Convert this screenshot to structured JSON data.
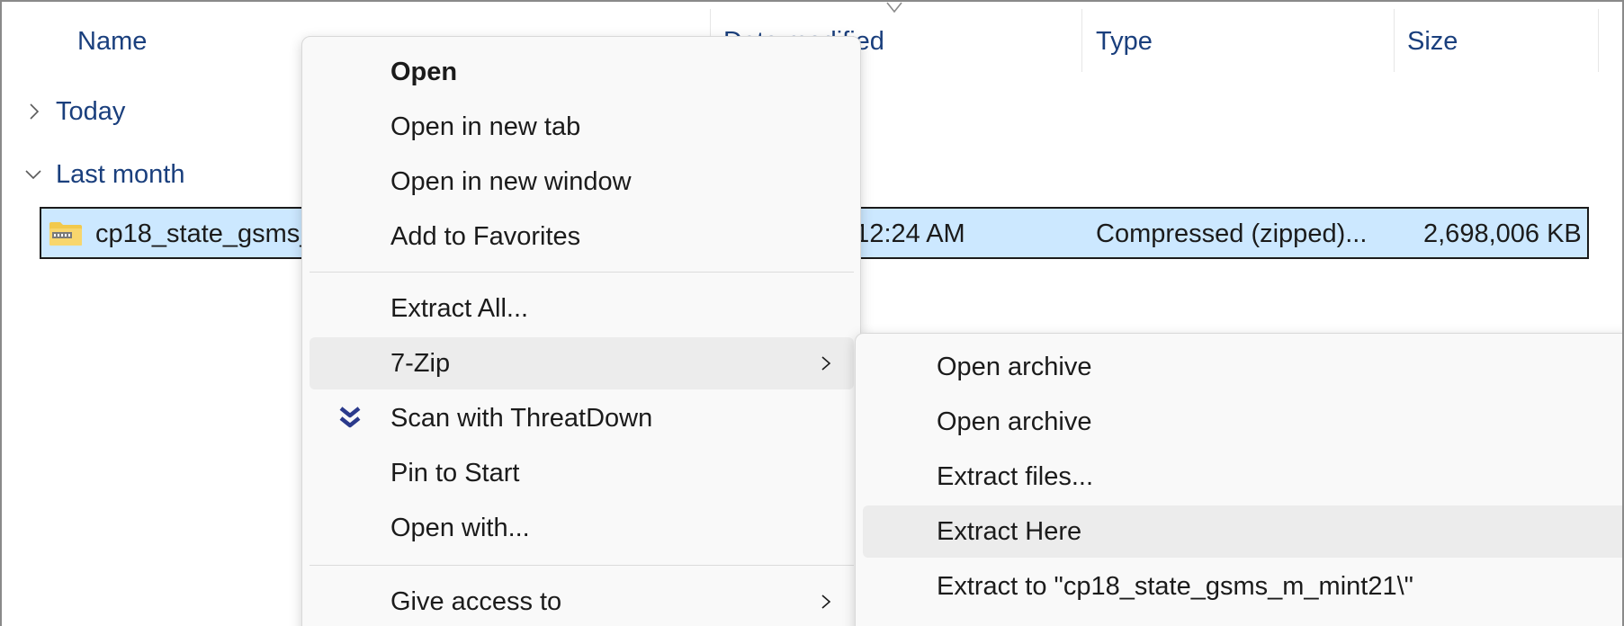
{
  "columns": {
    "name": "Name",
    "date_modified": "Date modified",
    "type": "Type",
    "size": "Size"
  },
  "groups": [
    {
      "label": "Today",
      "expanded": false
    },
    {
      "label": "Last month",
      "expanded": true
    }
  ],
  "file": {
    "name": "cp18_state_gsms_m_mint21.zip",
    "date_modified": "6 12:24 AM",
    "type": "Compressed (zipped)...",
    "size": "2,698,006 KB",
    "icon": "zip-folder-icon"
  },
  "context_menu": {
    "items": [
      {
        "label": "Open",
        "bold": true
      },
      {
        "label": "Open in new tab"
      },
      {
        "label": "Open in new window"
      },
      {
        "label": "Add to Favorites"
      },
      {
        "label": "Extract All..."
      },
      {
        "label": "7-Zip",
        "has_submenu": true,
        "highlighted": true
      },
      {
        "label": "Scan with ThreatDown",
        "icon": "threatdown-icon"
      },
      {
        "label": "Pin to Start"
      },
      {
        "label": "Open with..."
      },
      {
        "label": "Give access to",
        "has_submenu": true
      }
    ]
  },
  "submenu_7zip": {
    "items": [
      {
        "label": "Open archive"
      },
      {
        "label": "Open archive"
      },
      {
        "label": "Extract files..."
      },
      {
        "label": "Extract Here",
        "highlighted": true
      },
      {
        "label": "Extract to \"cp18_state_gsms_m_mint21\\\""
      }
    ]
  },
  "colors": {
    "selection": "#cce8ff",
    "group_text": "#1a3f7d",
    "menu_bg": "#f9f9f9",
    "menu_hover": "#ececec",
    "threatdown": "#2b3a8c"
  }
}
